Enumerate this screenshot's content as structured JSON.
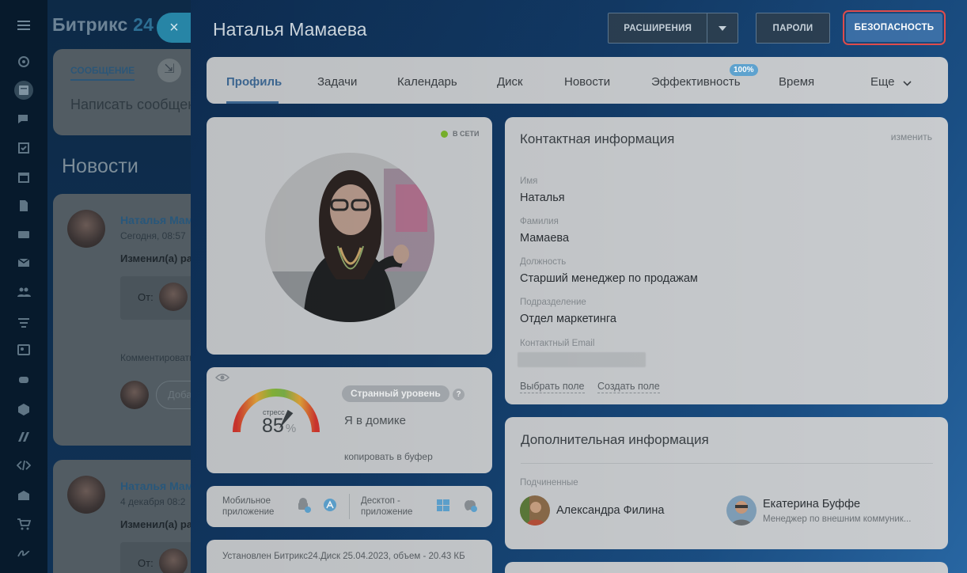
{
  "app": {
    "brand_name": "Битрикс",
    "brand_number": "24",
    "close_icon": "×"
  },
  "background": {
    "composer": {
      "tab_label": "СООБЩЕНИЕ",
      "placeholder": "Написать сообщение"
    },
    "news_title": "Новости",
    "posts": [
      {
        "author": "Наталья Мамаева",
        "date": "Сегодня, 08:57",
        "changed": "Изменил(а) ра",
        "from": "От:",
        "comment_label": "Комментировать",
        "comment_placeholder": "Доба"
      },
      {
        "author": "Наталья Мамаева",
        "date": "4 декабря 08:2",
        "changed": "Изменил(а) ра",
        "from": "От:"
      }
    ]
  },
  "profile": {
    "title": "Наталья Мамаева",
    "header_buttons": {
      "extensions": "РАСШИРЕНИЯ",
      "passwords": "ПАРОЛИ",
      "security": "БЕЗОПАСНОСТЬ"
    },
    "tabs": [
      {
        "label": "Профиль",
        "active": true
      },
      {
        "label": "Задачи"
      },
      {
        "label": "Календарь"
      },
      {
        "label": "Диск"
      },
      {
        "label": "Новости"
      },
      {
        "label": "Эффективность",
        "badge": "100%"
      },
      {
        "label": "Время"
      },
      {
        "label": "Еще"
      }
    ],
    "online_status": "В СЕТИ",
    "stress": {
      "label": "стресс",
      "value": "85",
      "unit": "%",
      "level": 0.85,
      "badge": "Странный уровень",
      "help": "?",
      "status": "Я в домике",
      "copy_link": "копировать в буфер"
    },
    "apps": {
      "mobile": "Мобильное приложение",
      "desktop": "Десктоп - приложение"
    },
    "installed_note": "Установлен Битрикс24.Диск 25.04.2023, объем - 20.43 КБ",
    "contact": {
      "heading": "Контактная информация",
      "edit": "изменить",
      "fields": [
        {
          "label": "Имя",
          "value": "Наталья"
        },
        {
          "label": "Фамилия",
          "value": "Мамаева"
        },
        {
          "label": "Должность",
          "value": "Старший менеджер по продажам"
        },
        {
          "label": "Подразделение",
          "value": "Отдел маркетинга"
        },
        {
          "label": "Контактный Email",
          "value": ""
        }
      ],
      "choose_field": "Выбрать поле",
      "create_field": "Создать поле"
    },
    "extra": {
      "heading": "Дополнительная информация",
      "subordinates_label": "Подчиненные",
      "subordinates": [
        {
          "name": "Александра Филина",
          "position": ""
        },
        {
          "name": "Екатерина Буффе",
          "position": "Менеджер по внешним коммуник..."
        }
      ]
    }
  },
  "colors": {
    "accent": "#3f6b97",
    "security_outline": "#e04c4c",
    "online": "#7bb52c"
  },
  "icons": [
    "menu-icon",
    "search-icon",
    "chevron-down-icon",
    "eye-icon",
    "android-icon",
    "app-store-icon",
    "windows-icon",
    "apple-icon"
  ]
}
